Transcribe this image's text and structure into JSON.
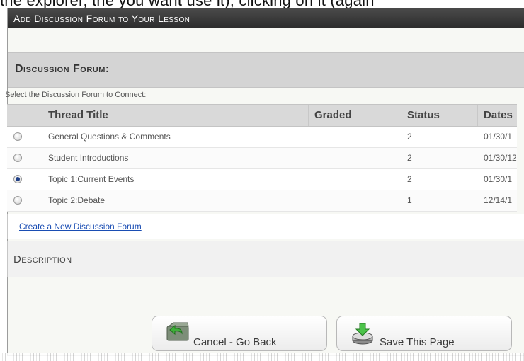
{
  "clipped_header_text": "the explorer, the you want use it), clicking on it (again",
  "dialog": {
    "title": "Add Discussion Forum to Your Lesson"
  },
  "section": {
    "heading": "Discussion Forum:",
    "instruction": "Select the Discussion Forum to Connect:"
  },
  "table": {
    "columns": [
      "Thread Title",
      "Graded",
      "Status",
      "Dates"
    ],
    "rows": [
      {
        "selected": false,
        "title": "General Questions & Comments",
        "graded": "",
        "status": "2",
        "dates": "01/30/1"
      },
      {
        "selected": false,
        "title": "Student Introductions",
        "graded": "",
        "status": "2",
        "dates": "01/30/12"
      },
      {
        "selected": true,
        "title": "Topic 1:Current Events",
        "graded": "",
        "status": "2",
        "dates": "01/30/1"
      },
      {
        "selected": false,
        "title": "Topic 2:Debate",
        "graded": "",
        "status": "1",
        "dates": "12/14/1"
      }
    ]
  },
  "create_link": "Create a New Discussion Forum",
  "description_label": "Description",
  "buttons": {
    "cancel": "Cancel - Go Back",
    "save": "Save This Page"
  },
  "colors": {
    "titlebar": "#333333",
    "section_bar": "#d4d4d4",
    "link": "#1a4db3",
    "selected_radio": "#1f3f86"
  }
}
